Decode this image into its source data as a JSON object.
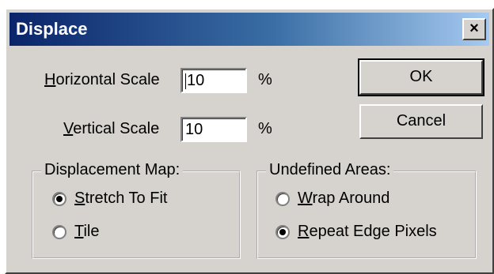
{
  "window": {
    "title": "Displace",
    "close_glyph": "×"
  },
  "scale": {
    "horizontal_label_mnemonic": "H",
    "horizontal_label_rest": "orizontal Scale",
    "horizontal_value": "10",
    "horizontal_unit": "%",
    "vertical_label_mnemonic": "V",
    "vertical_label_rest": "ertical Scale",
    "vertical_value": "10",
    "vertical_unit": "%"
  },
  "buttons": {
    "ok": "OK",
    "cancel": "Cancel"
  },
  "displacement_map": {
    "legend": "Displacement Map:",
    "options": [
      {
        "mnemonic": "S",
        "rest": "tretch To Fit",
        "selected": true
      },
      {
        "mnemonic": "T",
        "rest": "ile",
        "selected": false
      }
    ]
  },
  "undefined_areas": {
    "legend": "Undefined Areas:",
    "options": [
      {
        "mnemonic": "W",
        "rest": "rap Around",
        "selected": false
      },
      {
        "mnemonic": "R",
        "rest": "epeat Edge Pixels",
        "selected": true
      }
    ]
  },
  "icons": {
    "close": "close-icon",
    "radio": "radio-button-icon"
  }
}
